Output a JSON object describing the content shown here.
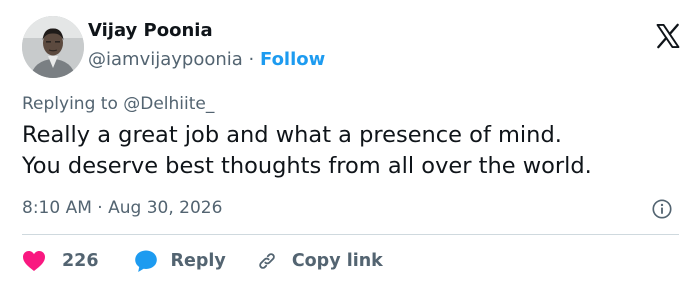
{
  "author": {
    "name": "Vijay Poonia",
    "handle": "@iamvijaypoonia",
    "separator": "·",
    "follow_label": "Follow"
  },
  "reply_context": "Replying to @Delhiite_",
  "tweet": {
    "lines": [
      "Really a great job and what a presence of mind.",
      "You deserve best thoughts from all over the world."
    ]
  },
  "meta": {
    "time": "8:10 AM",
    "separator": "·",
    "date": "Aug 30, 2026"
  },
  "actions": {
    "like_count": "226",
    "reply_label": "Reply",
    "copy_label": "Copy link"
  },
  "icons": {
    "logo": "x-logo-icon",
    "info": "info-icon",
    "like": "heart-icon",
    "reply": "speech-bubble-icon",
    "copy": "link-icon"
  },
  "colors": {
    "text": "#0f1419",
    "secondary": "#536471",
    "accent": "#1d9bf0",
    "like": "#f91880",
    "divider": "#cfd9de"
  }
}
